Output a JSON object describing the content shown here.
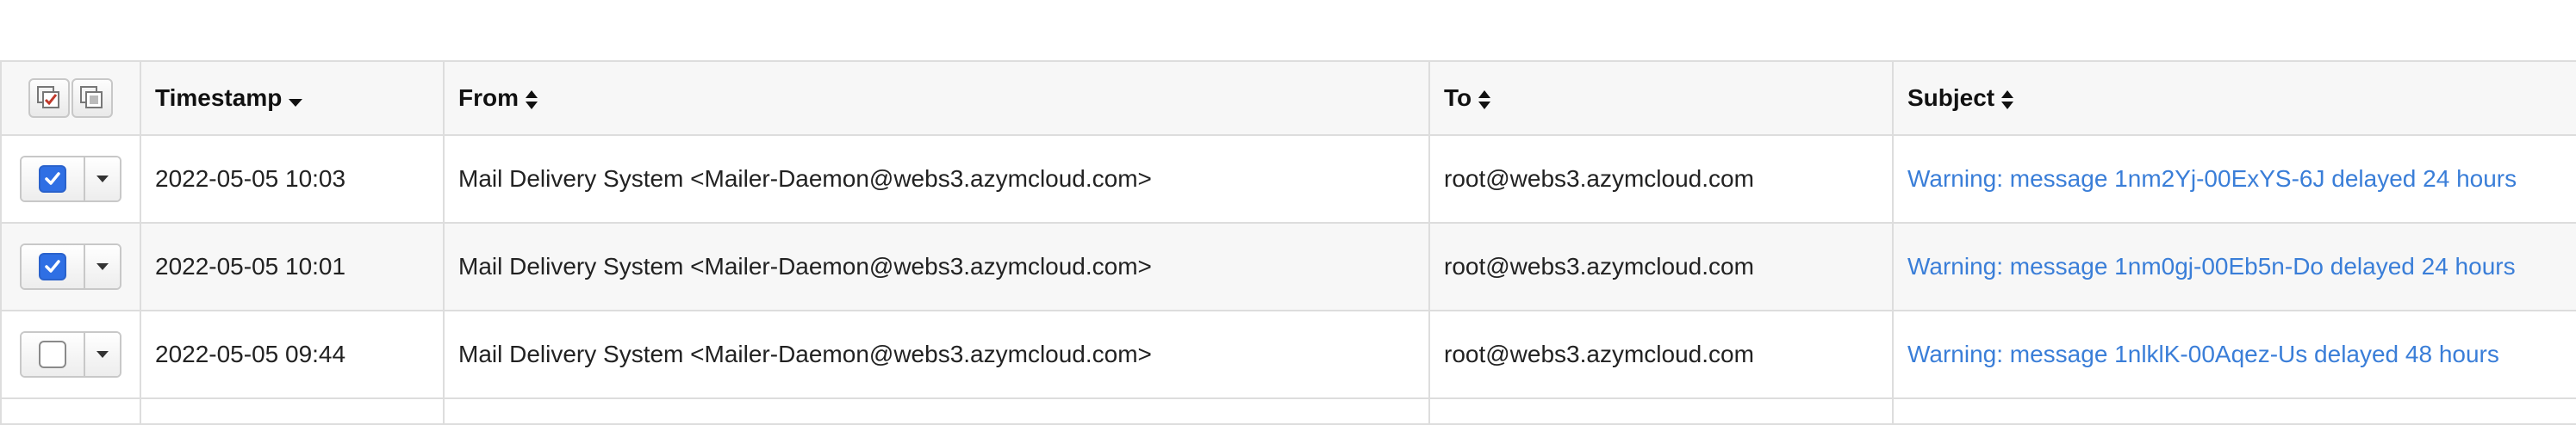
{
  "table": {
    "columns": [
      {
        "label": "Timestamp",
        "sort": "desc"
      },
      {
        "label": "From",
        "sort": "both"
      },
      {
        "label": "To",
        "sort": "both"
      },
      {
        "label": "Subject",
        "sort": "both"
      }
    ],
    "rows": [
      {
        "checked": true,
        "timestamp": "2022-05-05 10:03",
        "from": "Mail Delivery System <Mailer-Daemon@webs3.azymcloud.com>",
        "to": "root@webs3.azymcloud.com",
        "subject": "Warning: message 1nm2Yj-00ExYS-6J delayed 24 hours"
      },
      {
        "checked": true,
        "timestamp": "2022-05-05 10:01",
        "from": "Mail Delivery System <Mailer-Daemon@webs3.azymcloud.com>",
        "to": "root@webs3.azymcloud.com",
        "subject": "Warning: message 1nm0gj-00Eb5n-Do delayed 24 hours"
      },
      {
        "checked": false,
        "timestamp": "2022-05-05 09:44",
        "from": "Mail Delivery System <Mailer-Daemon@webs3.azymcloud.com>",
        "to": "root@webs3.azymcloud.com",
        "subject": "Warning: message 1nlklK-00Aqez-Us delayed 48 hours"
      }
    ]
  },
  "icons": {
    "select_all": "select-all-icon",
    "select_none": "select-none-icon",
    "row_menu": "chevron-down-icon",
    "checkbox": "checkbox-icon"
  },
  "colors": {
    "link": "#3a7ed8",
    "checkbox_checked": "#2f6fe4",
    "header_bg": "#f7f7f7",
    "border": "#dddddd"
  }
}
